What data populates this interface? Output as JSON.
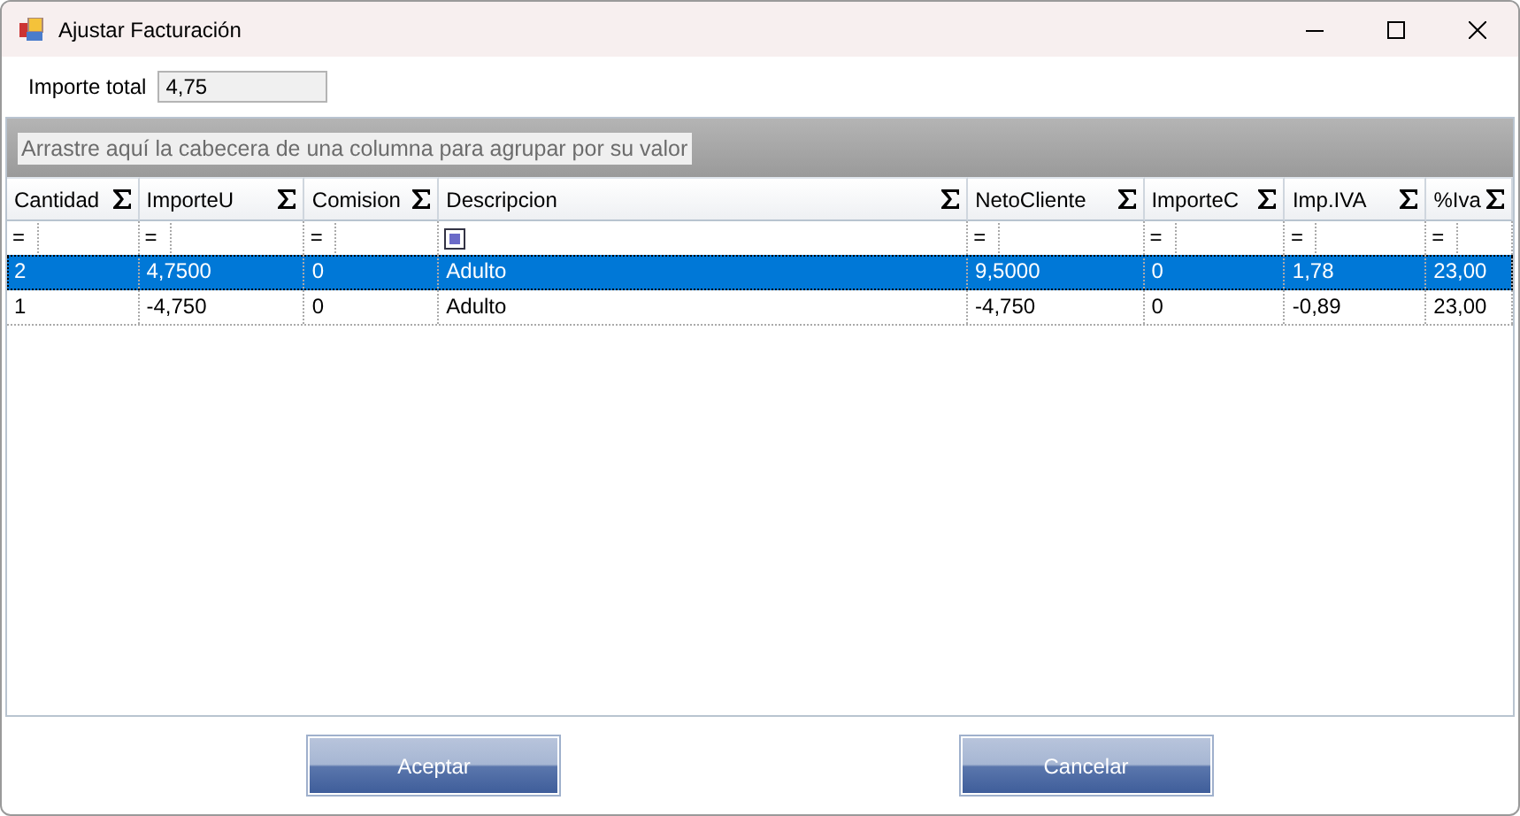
{
  "window": {
    "title": "Ajustar Facturación"
  },
  "total": {
    "label": "Importe total",
    "value": "4,75"
  },
  "group_panel": {
    "placeholder": "Arrastre aquí la cabecera de una columna para agrupar por su valor"
  },
  "columns": [
    {
      "label": "Cantidad",
      "filter": {
        "kind": "operator",
        "symbol": "="
      }
    },
    {
      "label": "ImporteU",
      "filter": {
        "kind": "operator",
        "symbol": "="
      }
    },
    {
      "label": "Comision",
      "filter": {
        "kind": "operator",
        "symbol": "="
      }
    },
    {
      "label": "Descripcion",
      "filter": {
        "kind": "check",
        "indeterminate": true
      }
    },
    {
      "label": "NetoCliente",
      "filter": {
        "kind": "operator",
        "symbol": "="
      }
    },
    {
      "label": "ImporteC",
      "filter": {
        "kind": "operator",
        "symbol": "="
      }
    },
    {
      "label": "Imp.IVA",
      "filter": {
        "kind": "operator",
        "symbol": "="
      }
    },
    {
      "label": "%Iva",
      "filter": {
        "kind": "operator",
        "symbol": "="
      }
    }
  ],
  "rows": [
    {
      "selected": true,
      "cells": [
        "2",
        "4,7500",
        "0",
        "Adulto",
        "9,5000",
        "0",
        "1,78",
        "23,00"
      ]
    },
    {
      "selected": false,
      "cells": [
        "1",
        "-4,750",
        "0",
        "Adulto",
        "-4,750",
        "0",
        "-0,89",
        "23,00"
      ]
    }
  ],
  "buttons": [
    "Aceptar",
    "Cancelar"
  ]
}
